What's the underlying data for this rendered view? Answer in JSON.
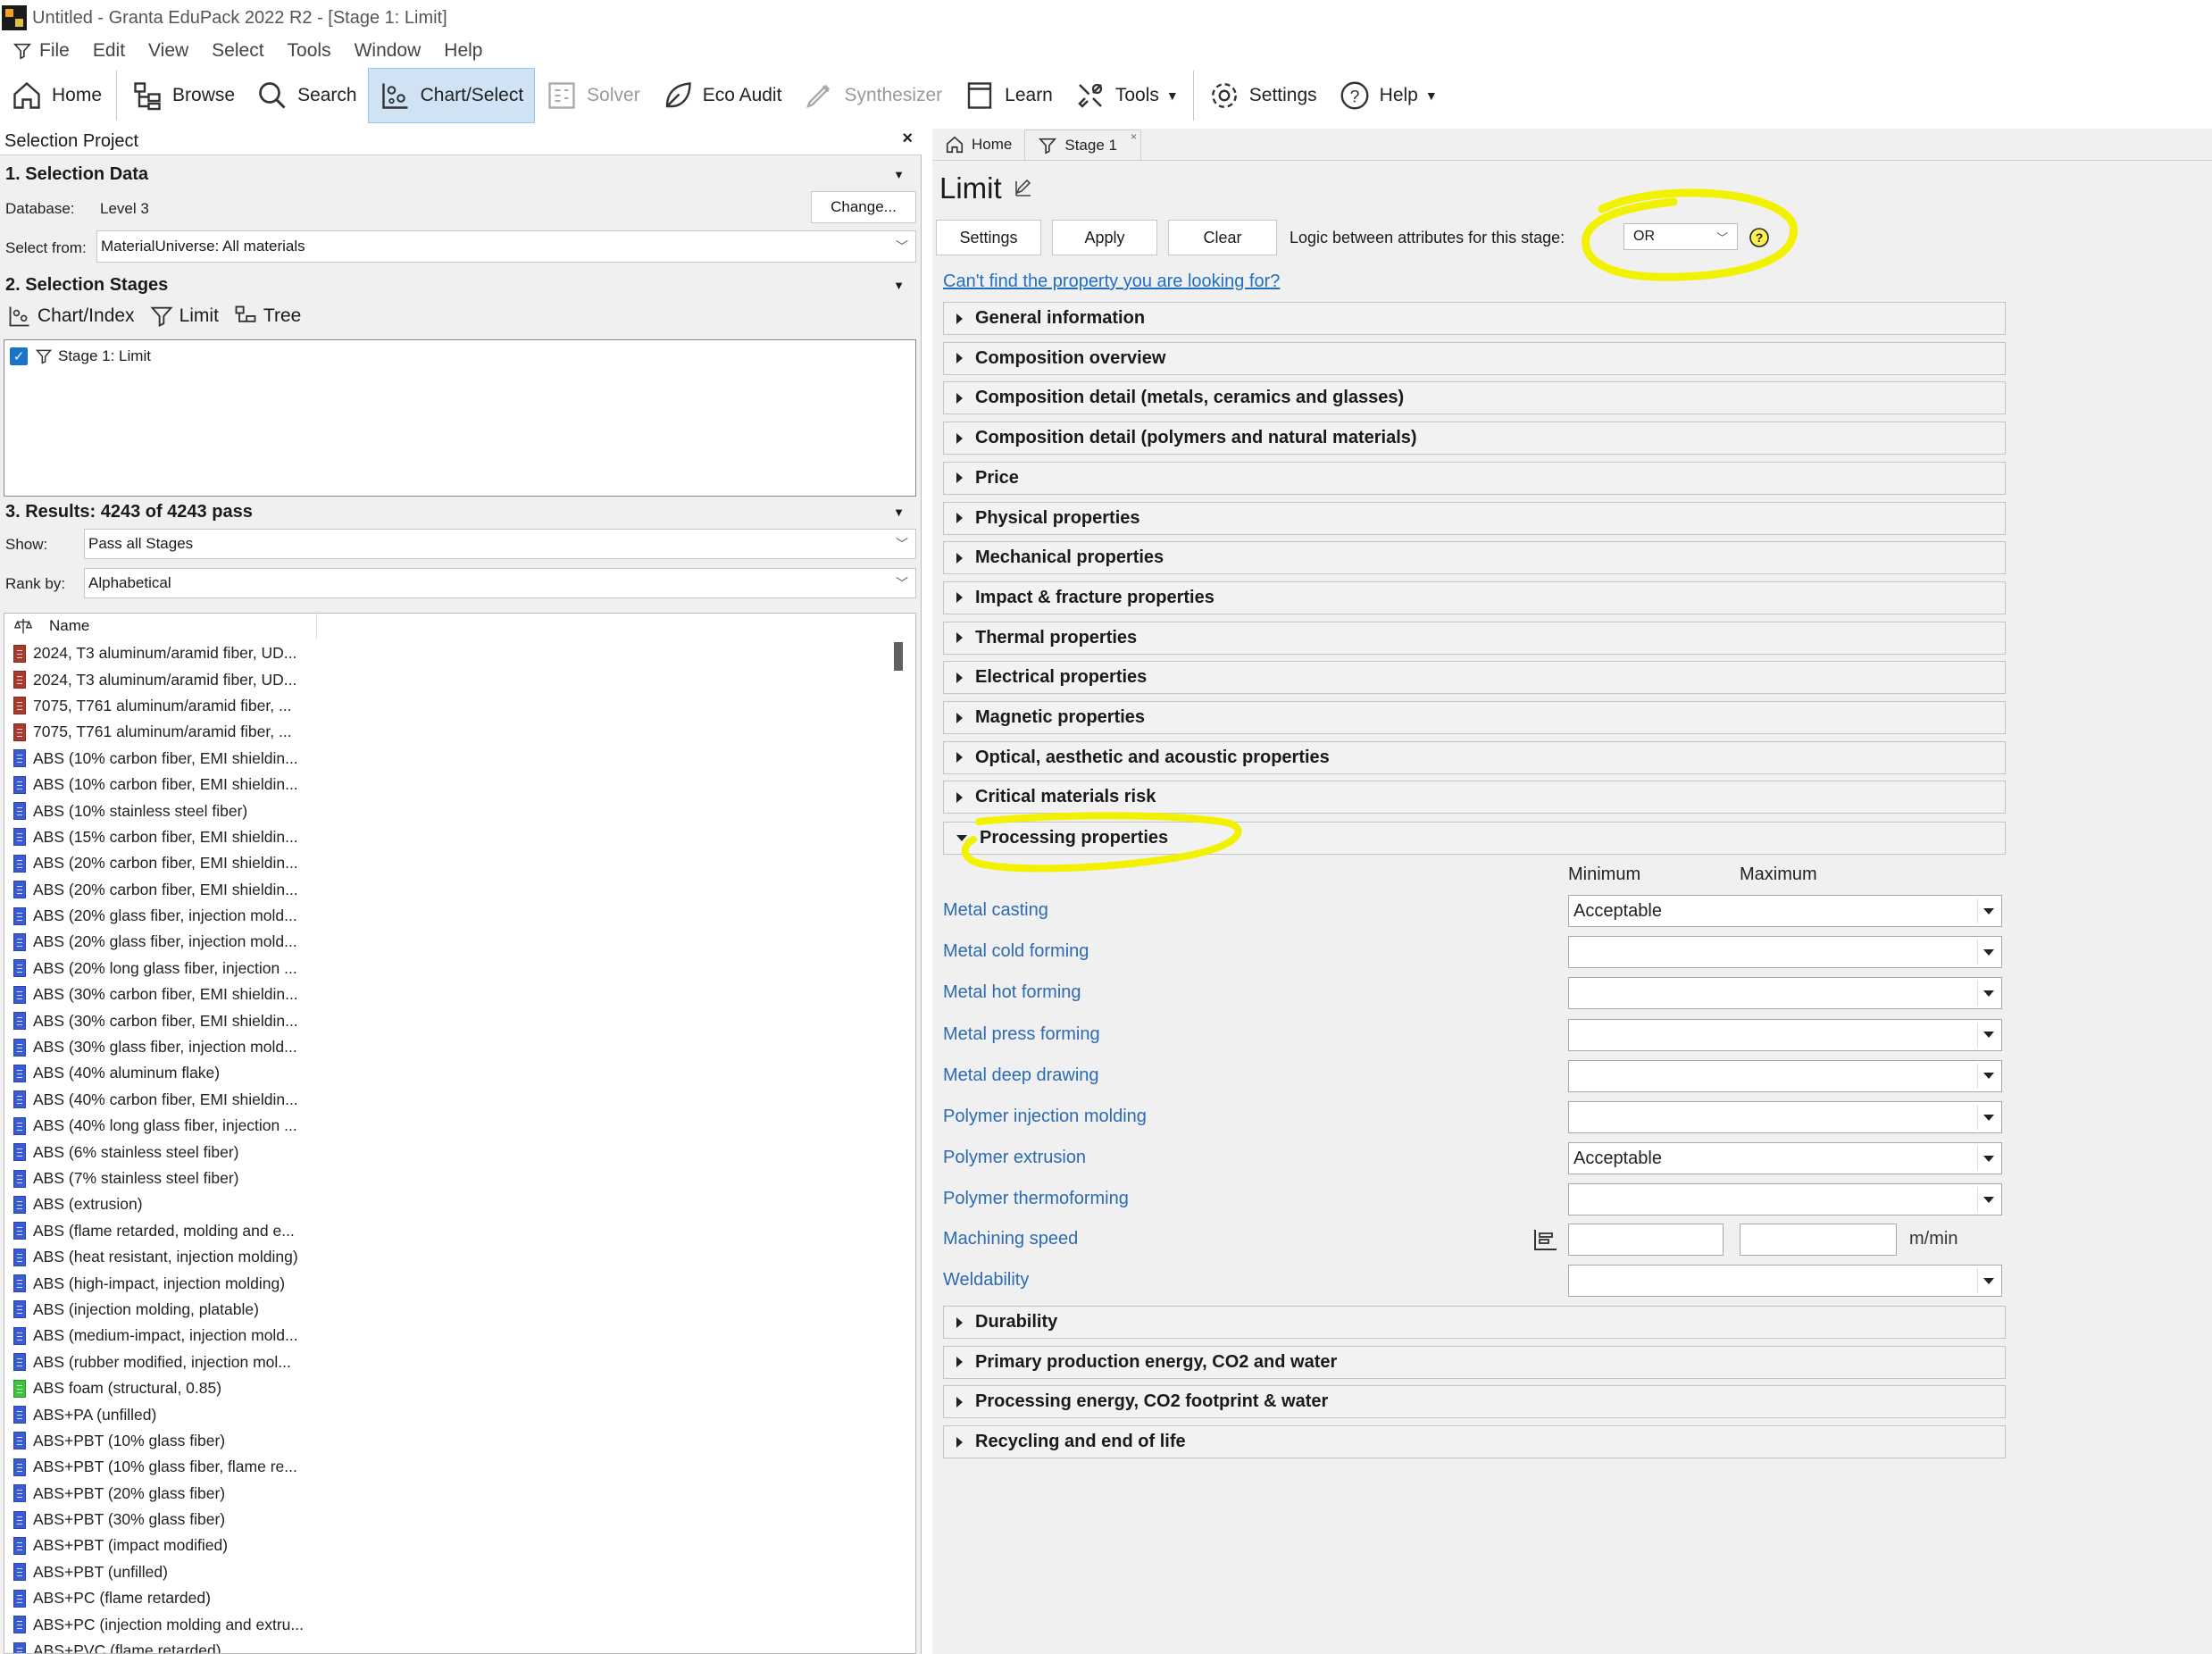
{
  "window": {
    "title": "Untitled - Granta EduPack 2022 R2 - [Stage 1: Limit]"
  },
  "menu": [
    "File",
    "Edit",
    "View",
    "Select",
    "Tools",
    "Window",
    "Help"
  ],
  "toolbar": {
    "home": "Home",
    "browse": "Browse",
    "search": "Search",
    "chart_select": "Chart/Select",
    "solver": "Solver",
    "eco_audit": "Eco Audit",
    "synthesizer": "Synthesizer",
    "learn": "Learn",
    "tools": "Tools",
    "settings": "Settings",
    "help": "Help"
  },
  "left": {
    "project_title": "Selection Project",
    "close": "×",
    "section1": "1. Selection Data",
    "database_label": "Database:",
    "database_value": "Level 3",
    "change_button": "Change...",
    "select_from_label": "Select from:",
    "select_from_value": "MaterialUniverse: All materials",
    "section2": "2. Selection Stages",
    "stage_tools": {
      "chart_index": "Chart/Index",
      "limit": "Limit",
      "tree": "Tree"
    },
    "stages": [
      "Stage 1: Limit"
    ],
    "section3": "3. Results: 4243 of 4243 pass",
    "show_label": "Show:",
    "show_value": "Pass all Stages",
    "rank_label": "Rank by:",
    "rank_value": "Alphabetical",
    "list_header": "Name",
    "results": [
      {
        "name": "2024, T3 aluminum/aramid fiber, UD...",
        "color": "#a83a2e"
      },
      {
        "name": "2024, T3 aluminum/aramid fiber, UD...",
        "color": "#a83a2e"
      },
      {
        "name": "7075, T761 aluminum/aramid fiber, ...",
        "color": "#a83a2e"
      },
      {
        "name": "7075, T761 aluminum/aramid fiber, ...",
        "color": "#a83a2e"
      },
      {
        "name": "ABS (10% carbon fiber, EMI shieldin...",
        "color": "#3a5bd6"
      },
      {
        "name": "ABS (10% carbon fiber, EMI shieldin...",
        "color": "#3a5bd6"
      },
      {
        "name": "ABS (10% stainless steel fiber)",
        "color": "#3a5bd6"
      },
      {
        "name": "ABS (15% carbon fiber, EMI shieldin...",
        "color": "#3a5bd6"
      },
      {
        "name": "ABS (20% carbon fiber, EMI shieldin...",
        "color": "#3a5bd6"
      },
      {
        "name": "ABS (20% carbon fiber, EMI shieldin...",
        "color": "#3a5bd6"
      },
      {
        "name": "ABS (20% glass fiber, injection mold...",
        "color": "#3a5bd6"
      },
      {
        "name": "ABS (20% glass fiber, injection mold...",
        "color": "#3a5bd6"
      },
      {
        "name": "ABS (20% long glass fiber, injection ...",
        "color": "#3a5bd6"
      },
      {
        "name": "ABS (30% carbon fiber, EMI shieldin...",
        "color": "#3a5bd6"
      },
      {
        "name": "ABS (30% carbon fiber, EMI shieldin...",
        "color": "#3a5bd6"
      },
      {
        "name": "ABS (30% glass fiber, injection mold...",
        "color": "#3a5bd6"
      },
      {
        "name": "ABS (40% aluminum flake)",
        "color": "#3a5bd6"
      },
      {
        "name": "ABS (40% carbon fiber, EMI shieldin...",
        "color": "#3a5bd6"
      },
      {
        "name": "ABS (40% long glass fiber, injection ...",
        "color": "#3a5bd6"
      },
      {
        "name": "ABS (6% stainless steel fiber)",
        "color": "#3a5bd6"
      },
      {
        "name": "ABS (7% stainless steel fiber)",
        "color": "#3a5bd6"
      },
      {
        "name": "ABS (extrusion)",
        "color": "#3a5bd6"
      },
      {
        "name": "ABS (flame retarded, molding and e...",
        "color": "#3a5bd6"
      },
      {
        "name": "ABS (heat resistant, injection molding)",
        "color": "#3a5bd6"
      },
      {
        "name": "ABS (high-impact, injection molding)",
        "color": "#3a5bd6"
      },
      {
        "name": "ABS (injection molding, platable)",
        "color": "#3a5bd6"
      },
      {
        "name": "ABS (medium-impact, injection mold...",
        "color": "#3a5bd6"
      },
      {
        "name": "ABS (rubber modified, injection mol...",
        "color": "#3a5bd6"
      },
      {
        "name": "ABS foam (structural, 0.85)",
        "color": "#3cc43c"
      },
      {
        "name": "ABS+PA (unfilled)",
        "color": "#3a5bd6"
      },
      {
        "name": "ABS+PBT (10% glass fiber)",
        "color": "#3a5bd6"
      },
      {
        "name": "ABS+PBT (10% glass fiber, flame re...",
        "color": "#3a5bd6"
      },
      {
        "name": "ABS+PBT (20% glass fiber)",
        "color": "#3a5bd6"
      },
      {
        "name": "ABS+PBT (30% glass fiber)",
        "color": "#3a5bd6"
      },
      {
        "name": "ABS+PBT (impact modified)",
        "color": "#3a5bd6"
      },
      {
        "name": "ABS+PBT (unfilled)",
        "color": "#3a5bd6"
      },
      {
        "name": "ABS+PC (flame retarded)",
        "color": "#3a5bd6"
      },
      {
        "name": "ABS+PC (injection molding and extru...",
        "color": "#3a5bd6"
      },
      {
        "name": "ABS+PVC (flame retarded)",
        "color": "#3a5bd6"
      }
    ]
  },
  "right": {
    "tabs": {
      "home": "Home",
      "stage": "Stage 1"
    },
    "tab_close": "×",
    "page_title": "Limit",
    "buttons": {
      "settings": "Settings",
      "apply": "Apply",
      "clear": "Clear"
    },
    "logic_label": "Logic between attributes for this stage:",
    "logic_value": "OR",
    "link": "Can't find the property you are looking for?",
    "sections_top": [
      "General information",
      "Composition overview",
      "Composition detail (metals, ceramics and glasses)",
      "Composition detail (polymers and natural materials)",
      "Price",
      "Physical properties",
      "Mechanical properties",
      "Impact & fracture properties",
      "Thermal properties",
      "Electrical properties",
      "Magnetic properties",
      "Optical, aesthetic and acoustic properties",
      "Critical materials risk"
    ],
    "open_section": "Processing properties",
    "col_min": "Minimum",
    "col_max": "Maximum",
    "processing": [
      {
        "label": "Metal casting",
        "value": "Acceptable"
      },
      {
        "label": "Metal cold forming",
        "value": ""
      },
      {
        "label": "Metal hot forming",
        "value": ""
      },
      {
        "label": "Metal press forming",
        "value": ""
      },
      {
        "label": "Metal deep drawing",
        "value": ""
      },
      {
        "label": "Polymer injection molding",
        "value": ""
      },
      {
        "label": "Polymer extrusion",
        "value": "Acceptable"
      },
      {
        "label": "Polymer thermoforming",
        "value": ""
      }
    ],
    "machining_label": "Machining speed",
    "machining_unit": "m/min",
    "weldability_label": "Weldability",
    "weldability_value": "",
    "sections_bottom": [
      "Durability",
      "Primary production energy, CO2 and water",
      "Processing energy, CO2 footprint & water",
      "Recycling and end of life"
    ]
  },
  "colors": {
    "accent": "#cfe3f5",
    "link": "#1f6fc4",
    "label_blue": "#2c6ab3",
    "highlight": "#f2f200"
  }
}
